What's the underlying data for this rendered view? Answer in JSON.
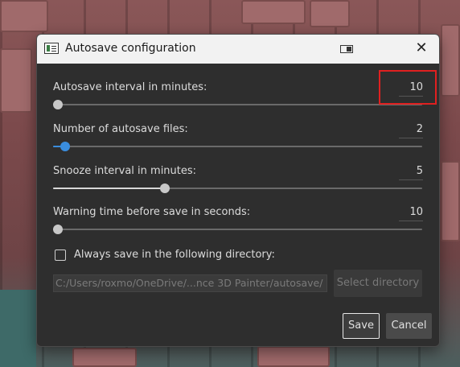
{
  "window": {
    "title": "Autosave configuration"
  },
  "settings": [
    {
      "label": "Autosave interval in minutes:",
      "value": "10",
      "level_fraction": 0.0,
      "thumb_color": "#c8c8c8"
    },
    {
      "label": "Number of autosave files:",
      "value": "2",
      "level_fraction": 0.02,
      "thumb_color": "#3a8dde"
    },
    {
      "label": "Snooze interval in minutes:",
      "value": "5",
      "level_fraction": 0.29,
      "thumb_color": "#c8c8c8"
    },
    {
      "label": "Warning time before save in seconds:",
      "value": "10",
      "level_fraction": 0.0,
      "thumb_color": "#c8c8c8"
    }
  ],
  "directory": {
    "checkbox_label": "Always save in the following directory:",
    "checked": false,
    "path": "C:/Users/roxmo/OneDrive/...nce 3D Painter/autosave/",
    "select_label": "Select directory"
  },
  "buttons": {
    "save": "Save",
    "cancel": "Cancel"
  },
  "colors": {
    "accent": "#3a8dde",
    "highlight": "#e02020",
    "dialog_bg": "#2e2e2e"
  },
  "icons": {
    "app": "app-window-icon",
    "snap": "snap-layout-icon",
    "close": "close-icon"
  }
}
